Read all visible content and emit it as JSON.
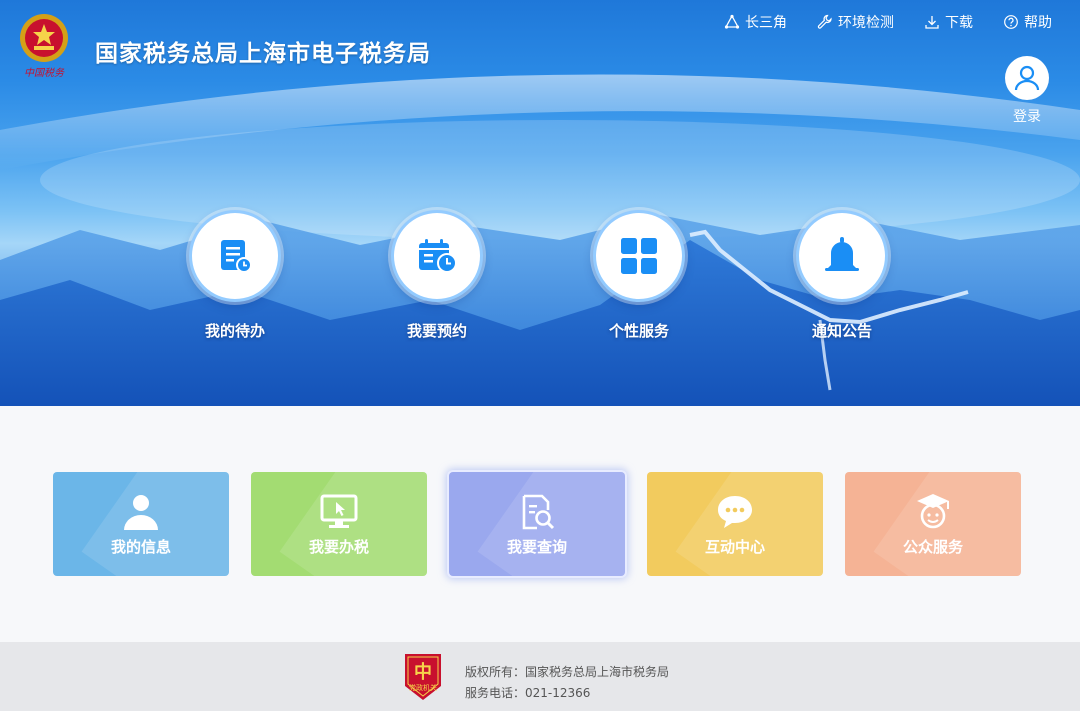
{
  "header": {
    "title": "国家税务总局上海市电子税务局",
    "emblem_caption": "中国税务"
  },
  "topnav": [
    {
      "label": "长三角",
      "icon": "triangle-nodes-icon"
    },
    {
      "label": "环境检测",
      "icon": "wrench-icon"
    },
    {
      "label": "下载",
      "icon": "download-icon"
    },
    {
      "label": "帮助",
      "icon": "help-icon"
    }
  ],
  "login": {
    "label": "登录",
    "icon": "user-avatar-icon"
  },
  "hero_functions": [
    {
      "label": "我的待办",
      "icon": "todo-list-icon"
    },
    {
      "label": "我要预约",
      "icon": "calendar-clock-icon"
    },
    {
      "label": "个性服务",
      "icon": "grid-apps-icon"
    },
    {
      "label": "通知公告",
      "icon": "bell-icon"
    }
  ],
  "cards": [
    {
      "label": "我的信息",
      "icon": "person-icon",
      "color": "#6bb6e8"
    },
    {
      "label": "我要办税",
      "icon": "monitor-cursor-icon",
      "color": "#a3dc72"
    },
    {
      "label": "我要查询",
      "icon": "document-search-icon",
      "color": "#9aa8ee"
    },
    {
      "label": "互动中心",
      "icon": "chat-bubble-icon",
      "color": "#f2cb5e"
    },
    {
      "label": "公众服务",
      "icon": "graduate-icon",
      "color": "#f5b395"
    }
  ],
  "footer": {
    "copyright": "版权所有：国家税务总局上海市税务局",
    "phone": "服务电话：021-12366",
    "badge_caption": "党政机关"
  },
  "colors": {
    "hero_primary": "#1f78d9",
    "icon_blue": "#1a8ef5",
    "footer_bg": "#e6e7ea"
  }
}
